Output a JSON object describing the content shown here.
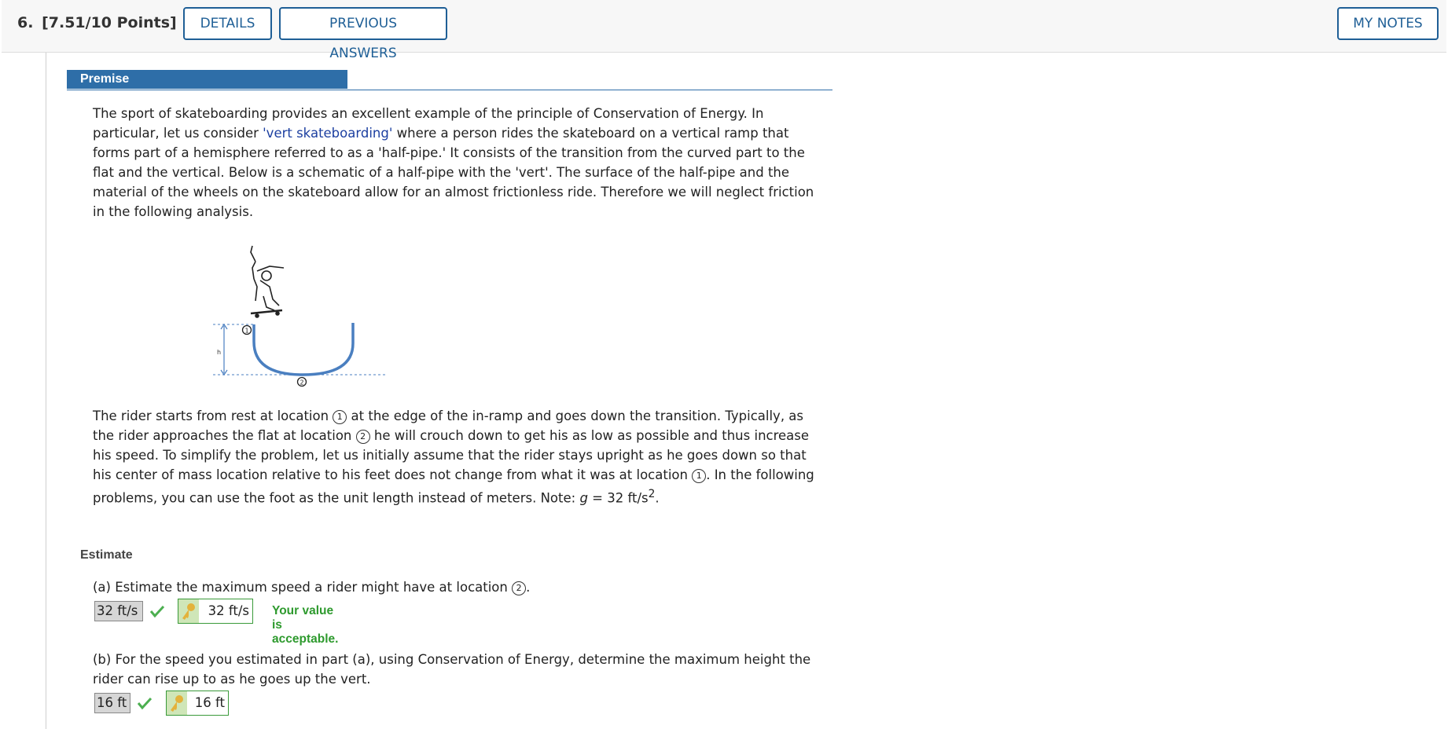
{
  "header": {
    "question_number": "6.",
    "points": "[7.51/10 Points]",
    "details_label": "DETAILS",
    "previous_answers_label": "PREVIOUS ANSWERS",
    "my_notes_label": "MY NOTES"
  },
  "premise": {
    "heading": "Premise",
    "para1_a": "The sport of skateboarding provides an excellent example of the principle of Conservation of Energy. In particular, let us consider ",
    "para1_link": "'vert skateboarding'",
    "para1_b": " where a person rides the skateboard on a vertical ramp that forms part of a hemisphere referred to as a 'half-pipe.' It consists of the transition from the curved part to the flat and the vertical. Below is a schematic of a half-pipe with the 'vert'. The surface of the half-pipe and the material of the wheels on the skateboard allow for an almost frictionless ride. Therefore we will neglect friction in the following analysis.",
    "para2_a": "The rider starts from rest at location ",
    "para2_b": " at the edge of the in-ramp and goes down the transition. Typically, as the rider approaches the flat at location ",
    "para2_c": " he will crouch down to get his as low as possible and thus increase his speed. To simplify the problem, let us initially assume that the rider stays upright as he goes down so that his center of mass location relative to his feet does not change from what it was at location ",
    "para2_d": ". In the following problems, you can use the foot as the unit length instead of meters. Note: ",
    "g_symbol": "g",
    "g_value": " = 32 ft/s",
    "g_exp": "2",
    "para2_end": "."
  },
  "figure": {
    "loc1": "1",
    "loc2": "2",
    "h_label": "h"
  },
  "estimate": {
    "heading": "Estimate",
    "qa_text": "(a) Estimate the maximum speed a rider might have at location ",
    "qa_end": ".",
    "qa_answer": "32 ft/s",
    "qa_key": "32 ft/s",
    "qa_feedback": "Your value is acceptable.",
    "qb_text": "(b) For the speed you estimated in part (a), using Conservation of Energy, determine the maximum height the rider can rise up to as he goes up the vert.",
    "qb_answer": "16 ft",
    "qb_key": "16 ft"
  },
  "icons": {
    "correct": "check-icon",
    "key": "key-icon"
  },
  "colors": {
    "accent": "#2e6ea8",
    "correct": "#2e9a2e",
    "link": "#1c3fa0"
  }
}
